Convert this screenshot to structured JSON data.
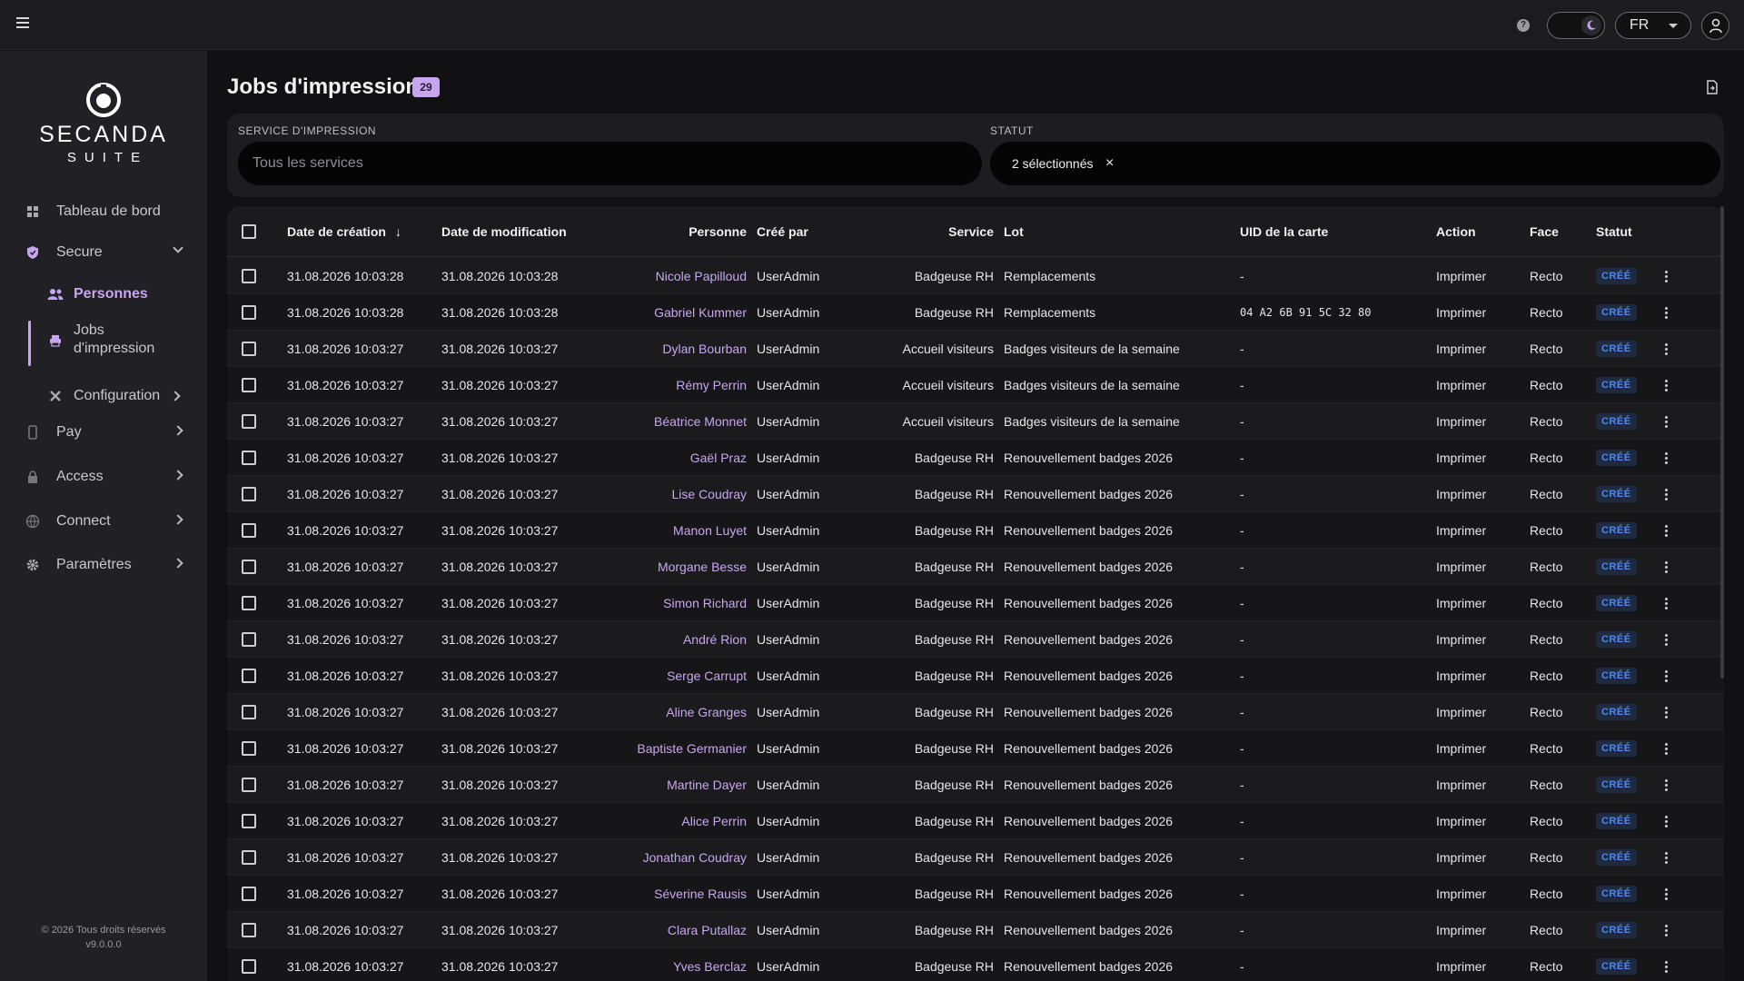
{
  "topbar": {
    "help": "?",
    "lang": "FR"
  },
  "logo": {
    "brand": "SECANDA",
    "suite": "SUITE"
  },
  "sidebar": {
    "items": [
      {
        "label": "Tableau de bord"
      },
      {
        "label": "Secure"
      },
      {
        "label": "Personnes"
      },
      {
        "label": "Jobs d'impression"
      },
      {
        "label": "Configuration"
      },
      {
        "label": "Pay"
      },
      {
        "label": "Access"
      },
      {
        "label": "Connect"
      },
      {
        "label": "Paramètres"
      }
    ],
    "footer": {
      "copyright": "© 2026 Tous droits réservés",
      "version": "v9.0.0.0"
    }
  },
  "page": {
    "title": "Jobs d'impression",
    "count": "29"
  },
  "filters": {
    "service_label": "SERVICE D'IMPRESSION",
    "service_placeholder": "Tous les services",
    "status_label": "STATUT",
    "status_value": "2 sélectionnés",
    "status_clear": "×"
  },
  "table": {
    "headers": [
      "Date de création",
      "Date de modification",
      "Personne",
      "Créé par",
      "Service",
      "Lot",
      "UID de la carte",
      "Action",
      "Face",
      "Statut"
    ],
    "sort_indicator": "↓",
    "rows": [
      [
        "31.08.2026 10:03:28",
        "31.08.2026 10:03:28",
        "Nicole Papilloud",
        "UserAdmin",
        "Badgeuse RH",
        "Remplacements",
        "-",
        "Imprimer",
        "Recto",
        "CRÉÉ"
      ],
      [
        "31.08.2026 10:03:28",
        "31.08.2026 10:03:28",
        "Gabriel Kummer",
        "UserAdmin",
        "Badgeuse RH",
        "Remplacements",
        "04 A2 6B 91 5C 32 80",
        "Imprimer",
        "Recto",
        "CRÉÉ"
      ],
      [
        "31.08.2026 10:03:27",
        "31.08.2026 10:03:27",
        "Dylan Bourban",
        "UserAdmin",
        "Accueil visiteurs",
        "Badges visiteurs de la semaine",
        "-",
        "Imprimer",
        "Recto",
        "CRÉÉ"
      ],
      [
        "31.08.2026 10:03:27",
        "31.08.2026 10:03:27",
        "Rémy Perrin",
        "UserAdmin",
        "Accueil visiteurs",
        "Badges visiteurs de la semaine",
        "-",
        "Imprimer",
        "Recto",
        "CRÉÉ"
      ],
      [
        "31.08.2026 10:03:27",
        "31.08.2026 10:03:27",
        "Béatrice Monnet",
        "UserAdmin",
        "Accueil visiteurs",
        "Badges visiteurs de la semaine",
        "-",
        "Imprimer",
        "Recto",
        "CRÉÉ"
      ],
      [
        "31.08.2026 10:03:27",
        "31.08.2026 10:03:27",
        "Gaël Praz",
        "UserAdmin",
        "Badgeuse RH",
        "Renouvellement badges 2026",
        "-",
        "Imprimer",
        "Recto",
        "CRÉÉ"
      ],
      [
        "31.08.2026 10:03:27",
        "31.08.2026 10:03:27",
        "Lise Coudray",
        "UserAdmin",
        "Badgeuse RH",
        "Renouvellement badges 2026",
        "-",
        "Imprimer",
        "Recto",
        "CRÉÉ"
      ],
      [
        "31.08.2026 10:03:27",
        "31.08.2026 10:03:27",
        "Manon Luyet",
        "UserAdmin",
        "Badgeuse RH",
        "Renouvellement badges 2026",
        "-",
        "Imprimer",
        "Recto",
        "CRÉÉ"
      ],
      [
        "31.08.2026 10:03:27",
        "31.08.2026 10:03:27",
        "Morgane Besse",
        "UserAdmin",
        "Badgeuse RH",
        "Renouvellement badges 2026",
        "-",
        "Imprimer",
        "Recto",
        "CRÉÉ"
      ],
      [
        "31.08.2026 10:03:27",
        "31.08.2026 10:03:27",
        "Simon Richard",
        "UserAdmin",
        "Badgeuse RH",
        "Renouvellement badges 2026",
        "-",
        "Imprimer",
        "Recto",
        "CRÉÉ"
      ],
      [
        "31.08.2026 10:03:27",
        "31.08.2026 10:03:27",
        "André Rion",
        "UserAdmin",
        "Badgeuse RH",
        "Renouvellement badges 2026",
        "-",
        "Imprimer",
        "Recto",
        "CRÉÉ"
      ],
      [
        "31.08.2026 10:03:27",
        "31.08.2026 10:03:27",
        "Serge Carrupt",
        "UserAdmin",
        "Badgeuse RH",
        "Renouvellement badges 2026",
        "-",
        "Imprimer",
        "Recto",
        "CRÉÉ"
      ],
      [
        "31.08.2026 10:03:27",
        "31.08.2026 10:03:27",
        "Aline Granges",
        "UserAdmin",
        "Badgeuse RH",
        "Renouvellement badges 2026",
        "-",
        "Imprimer",
        "Recto",
        "CRÉÉ"
      ],
      [
        "31.08.2026 10:03:27",
        "31.08.2026 10:03:27",
        "Baptiste Germanier",
        "UserAdmin",
        "Badgeuse RH",
        "Renouvellement badges 2026",
        "-",
        "Imprimer",
        "Recto",
        "CRÉÉ"
      ],
      [
        "31.08.2026 10:03:27",
        "31.08.2026 10:03:27",
        "Martine Dayer",
        "UserAdmin",
        "Badgeuse RH",
        "Renouvellement badges 2026",
        "-",
        "Imprimer",
        "Recto",
        "CRÉÉ"
      ],
      [
        "31.08.2026 10:03:27",
        "31.08.2026 10:03:27",
        "Alice Perrin",
        "UserAdmin",
        "Badgeuse RH",
        "Renouvellement badges 2026",
        "-",
        "Imprimer",
        "Recto",
        "CRÉÉ"
      ],
      [
        "31.08.2026 10:03:27",
        "31.08.2026 10:03:27",
        "Jonathan Coudray",
        "UserAdmin",
        "Badgeuse RH",
        "Renouvellement badges 2026",
        "-",
        "Imprimer",
        "Recto",
        "CRÉÉ"
      ],
      [
        "31.08.2026 10:03:27",
        "31.08.2026 10:03:27",
        "Séverine Rausis",
        "UserAdmin",
        "Badgeuse RH",
        "Renouvellement badges 2026",
        "-",
        "Imprimer",
        "Recto",
        "CRÉÉ"
      ],
      [
        "31.08.2026 10:03:27",
        "31.08.2026 10:03:27",
        "Clara Putallaz",
        "UserAdmin",
        "Badgeuse RH",
        "Renouvellement badges 2026",
        "-",
        "Imprimer",
        "Recto",
        "CRÉÉ"
      ],
      [
        "31.08.2026 10:03:27",
        "31.08.2026 10:03:27",
        "Yves Berclaz",
        "UserAdmin",
        "Badgeuse RH",
        "Renouvellement badges 2026",
        "-",
        "Imprimer",
        "Recto",
        "CRÉÉ"
      ]
    ]
  },
  "colors": {
    "accent": "#c7a6f0",
    "status_text": "#4a8cf0",
    "status_bg": "#1e2a40"
  }
}
